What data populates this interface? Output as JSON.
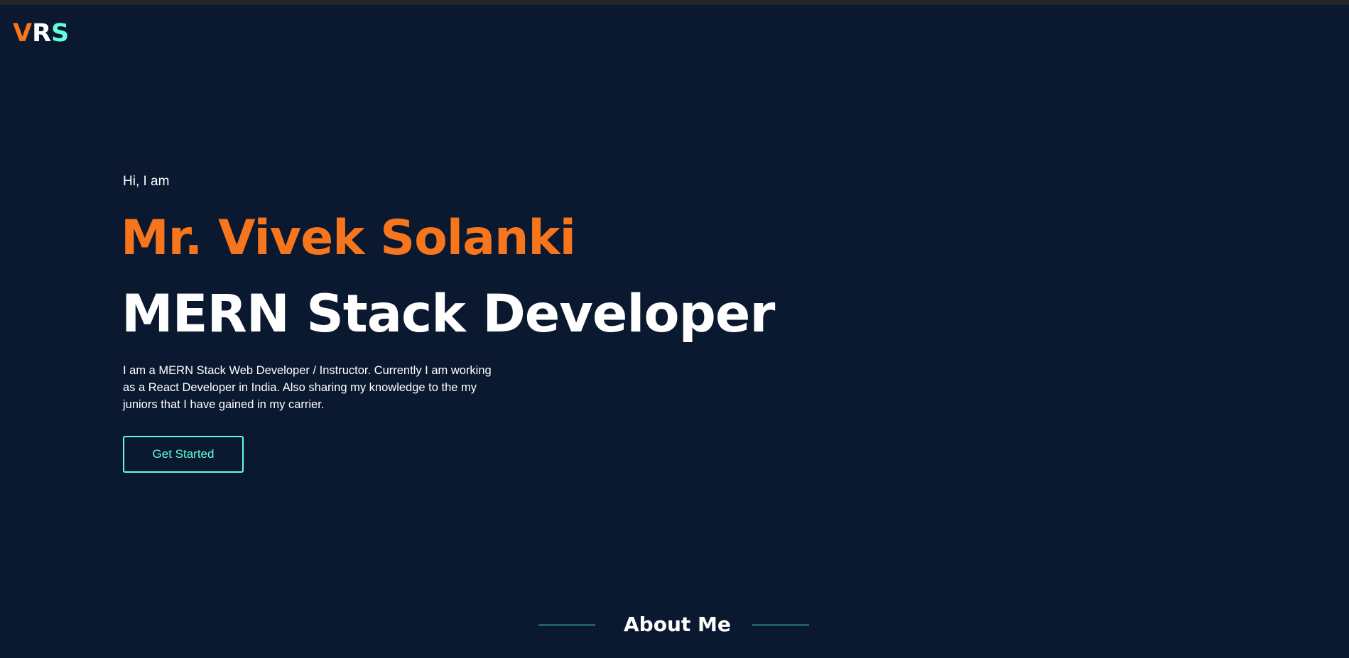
{
  "colors": {
    "background": "#0a192f",
    "accent_orange": "#f7751c",
    "accent_teal": "#64ffda",
    "text": "#ffffff"
  },
  "logo": {
    "letters": [
      "V",
      "R",
      "S"
    ],
    "letter_colors": [
      "#f7751c",
      "#ffffff",
      "#64ffda"
    ]
  },
  "hero": {
    "greeting": "Hi, I am",
    "name": "Mr. Vivek Solanki",
    "role": "MERN Stack Developer",
    "description": "I am a MERN Stack Web Developer / Instructor. Currently I am working as a React Developer in India. Also sharing my knowledge to the my juniors that I have gained in my carrier.",
    "cta_label": "Get Started"
  },
  "about": {
    "title": "About Me"
  }
}
